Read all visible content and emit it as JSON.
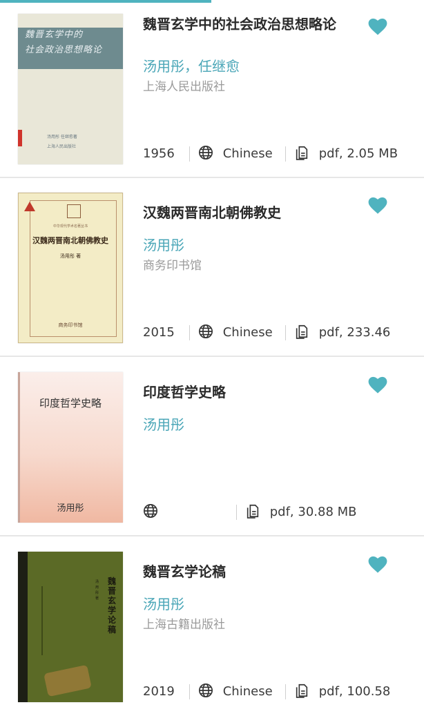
{
  "books": [
    {
      "title": "魏晋玄学中的社会政治思想略论",
      "author": " 汤用彤，任继愈",
      "publisher": "上海人民出版社",
      "year": "1956",
      "language": "Chinese",
      "file": "pdf, 2.05 MB",
      "cover_text": [
        "魏晋玄学中的",
        "社会政治思想略论"
      ],
      "cover_foot": [
        "汤用彤 任继愈著",
        "上海人民出版社"
      ]
    },
    {
      "title": "汉魏两晋南北朝佛教史",
      "author": "汤用彤",
      "publisher": "商务印书馆",
      "year": "2015",
      "language": "Chinese",
      "file": "pdf, 233.46",
      "cover_series": "中华现代学术名著丛书",
      "cover_title": "汉魏两晋南北朝佛教史",
      "cover_author": "汤用彤 著",
      "cover_publisher": "商务印书馆"
    },
    {
      "title": "印度哲学史略",
      "author": "汤用彤",
      "publisher": "",
      "year": "",
      "language": "",
      "file": "pdf, 30.88 MB",
      "cover_title": "印度哲学史略",
      "cover_author": "汤用彤"
    },
    {
      "title": "魏晋玄学论稿",
      "author": "汤用彤",
      "publisher": "上海古籍出版社",
      "year": "2019",
      "language": "Chinese",
      "file": "pdf, 100.58",
      "cover_title": "魏晋玄学论稿",
      "cover_author": "汤用彤 著"
    }
  ],
  "colors": {
    "accent": "#4fb3bf",
    "author": "#4aa6b7",
    "publisher": "#9a9a9a"
  },
  "icons": {
    "favorite": "heart-icon",
    "language": "globe-icon",
    "file": "file-icon"
  },
  "reading_progress": 0.5
}
